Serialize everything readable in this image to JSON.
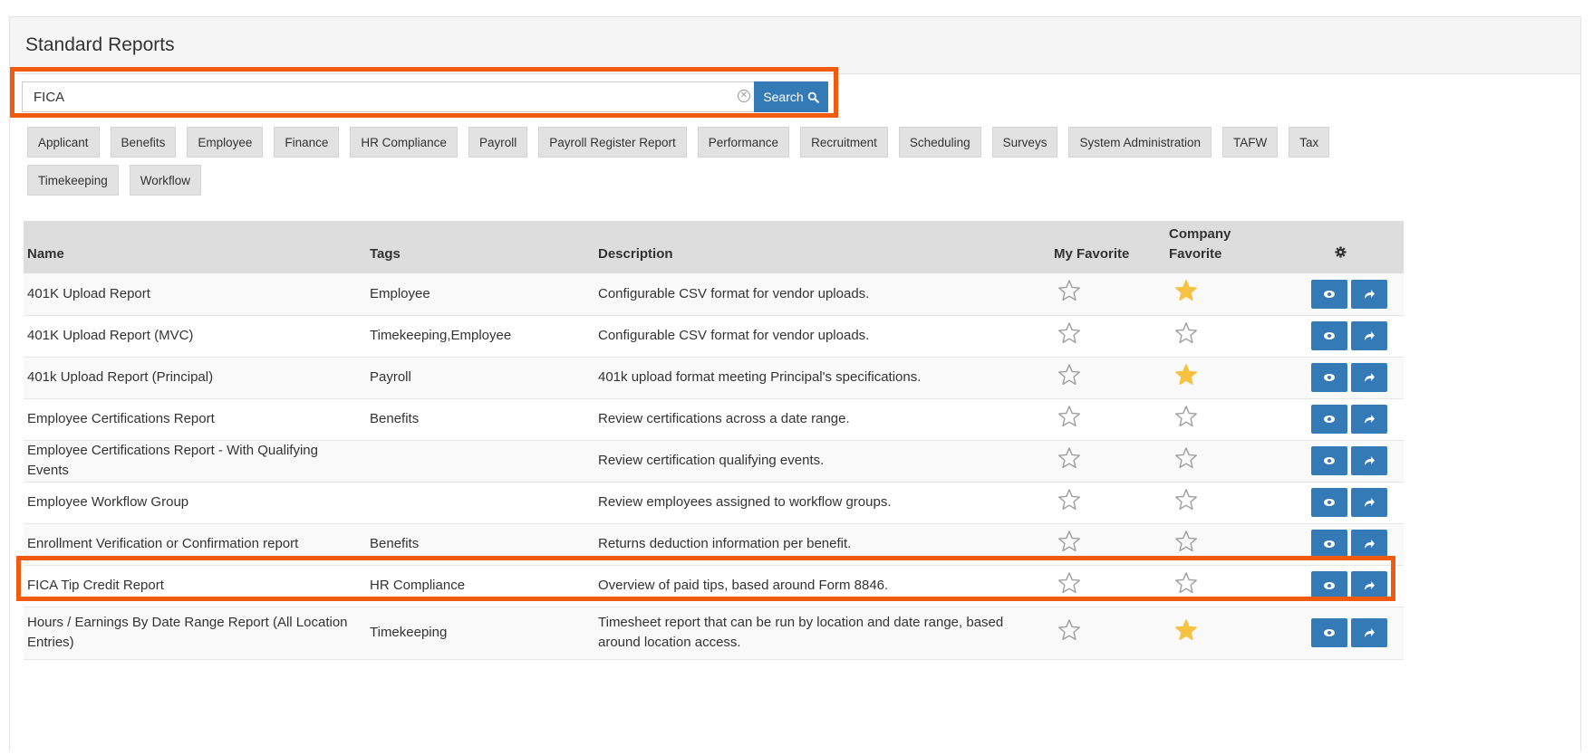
{
  "panel": {
    "title": "Standard Reports"
  },
  "search": {
    "value": "FICA",
    "button_label": "Search"
  },
  "tags": [
    "Applicant",
    "Benefits",
    "Employee",
    "Finance",
    "HR Compliance",
    "Payroll",
    "Payroll Register Report",
    "Performance",
    "Recruitment",
    "Scheduling",
    "Surveys",
    "System Administration",
    "TAFW",
    "Tax",
    "Timekeeping",
    "Workflow"
  ],
  "table": {
    "headers": {
      "name": "Name",
      "tags": "Tags",
      "description": "Description",
      "my_favorite": "My Favorite",
      "company_favorite_line1": "Company",
      "company_favorite_line2": "Favorite"
    },
    "rows": [
      {
        "name": "401K Upload Report",
        "tags": "Employee",
        "description": "Configurable CSV format for vendor uploads.",
        "my_favorite": false,
        "company_favorite": true
      },
      {
        "name": "401K Upload Report (MVC)",
        "tags": "Timekeeping,Employee",
        "description": "Configurable CSV format for vendor uploads.",
        "my_favorite": false,
        "company_favorite": false
      },
      {
        "name": "401k Upload Report (Principal)",
        "tags": "Payroll",
        "description": "401k upload format meeting Principal's specifications.",
        "my_favorite": false,
        "company_favorite": true
      },
      {
        "name": "Employee Certifications Report",
        "tags": "Benefits",
        "description": "Review certifications across a date range.",
        "my_favorite": false,
        "company_favorite": false
      },
      {
        "name": "Employee Certifications Report - With Qualifying Events",
        "tags": "",
        "description": "Review certification qualifying events.",
        "my_favorite": false,
        "company_favorite": false
      },
      {
        "name": "Employee Workflow Group",
        "tags": "",
        "description": "Review employees assigned to workflow groups.",
        "my_favorite": false,
        "company_favorite": false
      },
      {
        "name": "Enrollment Verification or Confirmation report",
        "tags": "Benefits",
        "description": "Returns deduction information per benefit.",
        "my_favorite": false,
        "company_favorite": false
      },
      {
        "name": "FICA Tip Credit Report",
        "tags": "HR Compliance",
        "description": "Overview of paid tips, based around Form 8846.",
        "my_favorite": false,
        "company_favorite": false
      },
      {
        "name": "Hours / Earnings By Date Range Report (All Location Entries)",
        "tags": "Timekeeping",
        "description": "Timesheet report that can be run by location and date range, based around location access.",
        "my_favorite": false,
        "company_favorite": true
      }
    ]
  },
  "icons": {
    "search": "search-icon",
    "clear": "clear-circle-icon",
    "settings": "gear-icon",
    "view": "eye-icon",
    "run": "share-arrow-icon",
    "star_empty": "star-outline-icon",
    "star_filled": "star-filled-icon"
  },
  "colors": {
    "primary": "#337ab7",
    "highlight": "#f25a0f",
    "star_filled": "#f5c242",
    "star_empty": "#9e9e9e",
    "header_bg": "#dddddd",
    "tag_bg": "#e2e2e2"
  }
}
